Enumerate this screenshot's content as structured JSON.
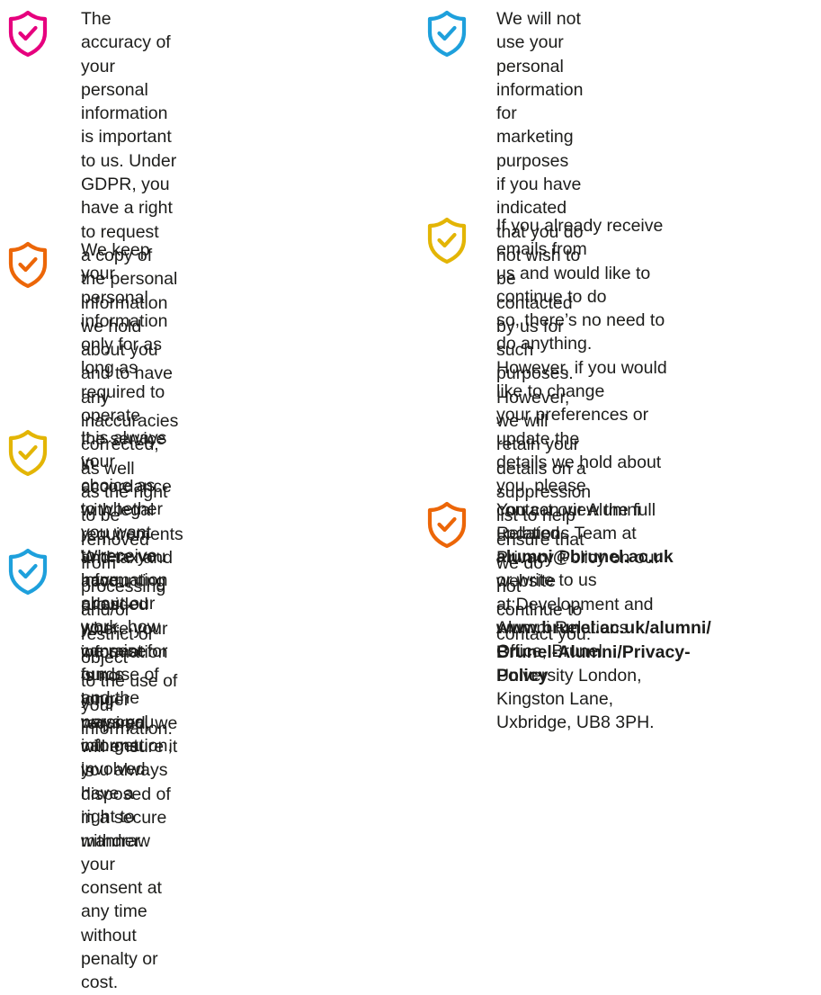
{
  "colors": {
    "pink": "#e6007e",
    "orange": "#ec6608",
    "yellow": "#e3b505",
    "blue": "#1ea0dc",
    "text": "#1d1d1b"
  },
  "left_column": [
    {
      "icon": "shield-check-icon",
      "color": "pink",
      "text": "The accuracy of your personal\ninformation is important to us. Under\nGDPR, you have a right to request\na copy of the personal information\nwe hold about you and to have\nany inaccuracies corrected, as well\nas the right to be removed from\nprocessing and/or restrict or object\nto the use of your information."
    },
    {
      "icon": "shield-check-icon",
      "color": "orange",
      "text": "We keep your personal information\nonly for as long as required to operate\nthe service in accordance with legal\nrequirements and tax and accounting\nrules – where your information is no\nlonger required, we will ensure it is\ndisposed of in a secure manner."
    },
    {
      "icon": "shield-check-icon",
      "color": "yellow",
      "text": "It is always your choice as to whether\nyou want to receive information\nabout our work, how we raise funds\nand the ways you can get involved."
    },
    {
      "icon": "shield-check-icon",
      "color": "blue",
      "text": "Where you have provided your\nconsent for our use of your personal\ninformation, you always have a\nright to withdraw your consent at\nany time without penalty or cost."
    }
  ],
  "right_column": [
    {
      "icon": "shield-check-icon",
      "color": "blue",
      "text": "We will not use your personal\ninformation for marketing purposes\nif you have indicated that you do\nnot wish to be contacted by us for\nsuch purposes. However, we will\nretain your details on a suppression\nlist to help ensure that we do\nnot continue to contact you."
    },
    {
      "icon": "shield-check-icon",
      "color": "yellow",
      "text_before": "If you already receive emails from\nus and would like to continue to do\nso, there’s no need to do anything.\nHowever, if you would like to change\nyour preferences or update the\ndetails we hold about you, please\ncontact our Alumni Relations Team at\n",
      "email": "alumni@brunel.ac.uk",
      "text_after": " or write to us\nat Development and Alumni Relations\nOffice, Brunel University London,\nKingston Lane, Uxbridge, UB8 3PH."
    },
    {
      "icon": "shield-check-icon",
      "color": "orange",
      "text_before": "You can view the full updated\nPrivacy Policy on our website\nat: ",
      "link_line1": "www.brunel.ac.uk/alumni/",
      "link_line2": "Brunel-Alumni/Privacy-Policy"
    }
  ]
}
